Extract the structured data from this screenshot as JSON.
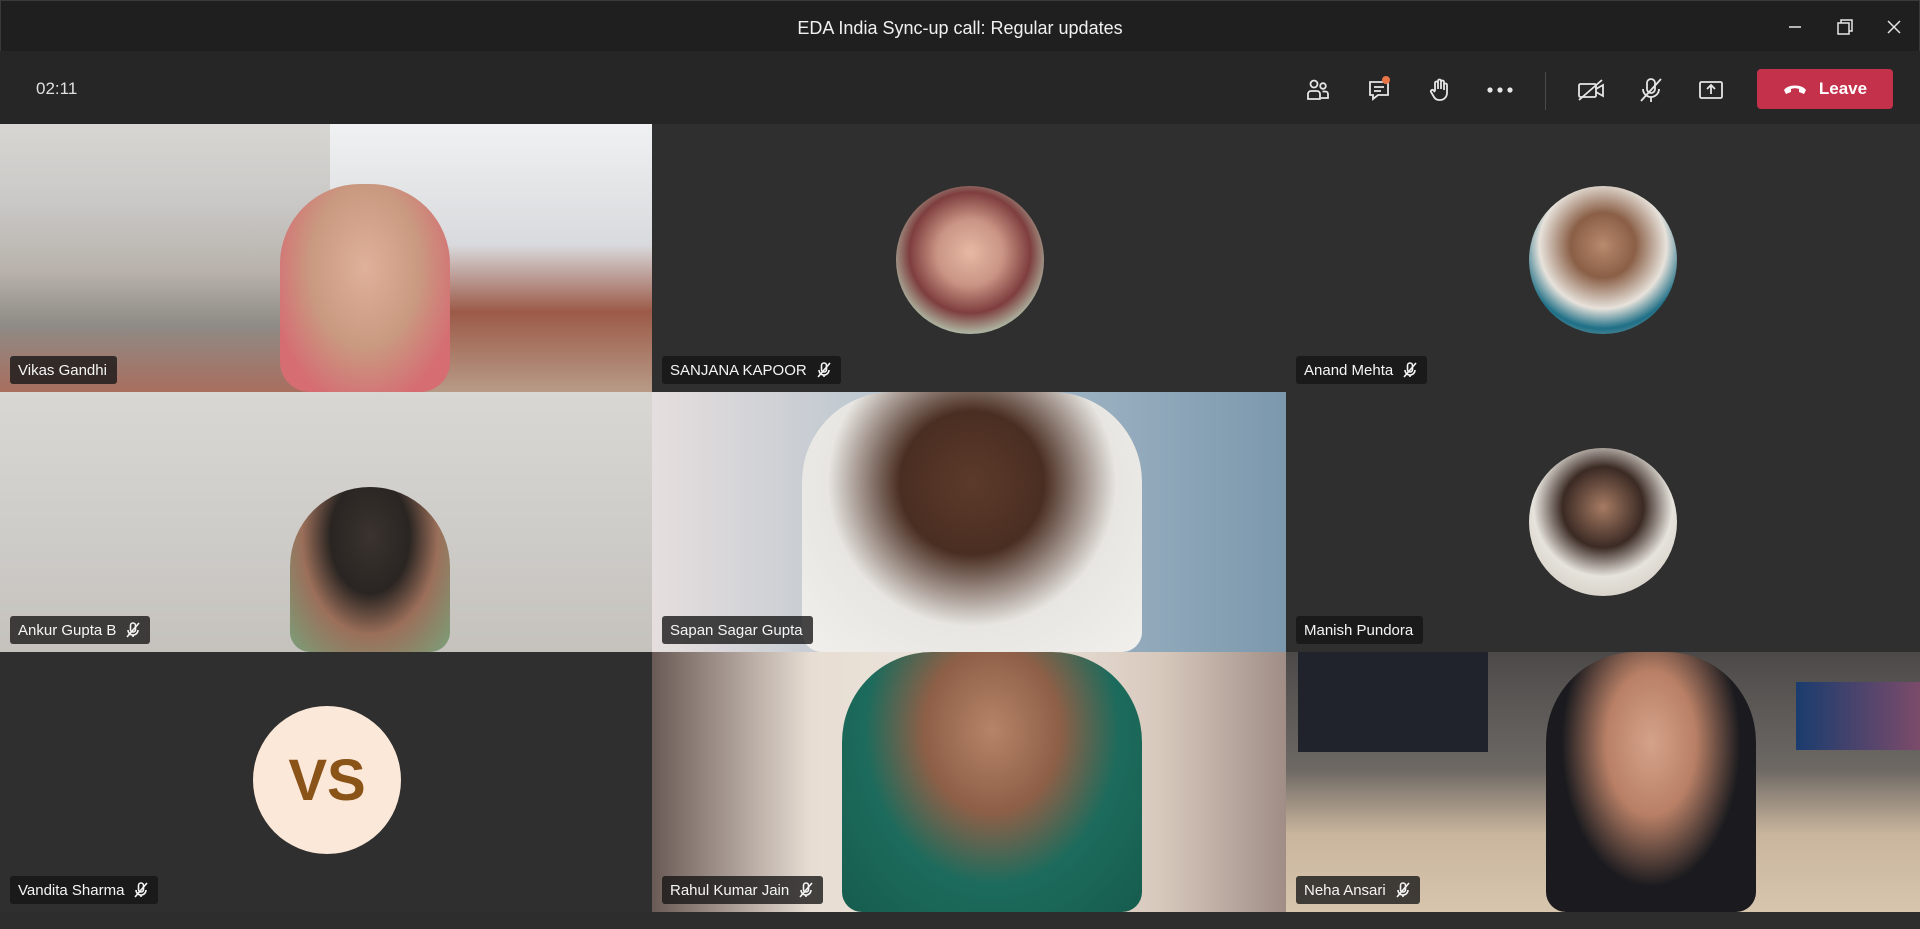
{
  "window": {
    "title": "EDA India Sync-up call: Regular updates"
  },
  "toolbar": {
    "timer": "02:11",
    "leave_label": "Leave",
    "icons": [
      "people-icon",
      "chat-icon",
      "raise-hand-icon",
      "more-icon",
      "camera-off-icon",
      "mic-off-icon",
      "share-screen-icon",
      "hang-up-icon"
    ],
    "leave_color": "#c4314b",
    "chat_notification_color": "#e97548"
  },
  "participants": [
    {
      "name": "Vikas Gandhi",
      "muted": false,
      "mode": "video"
    },
    {
      "name": "SANJANA KAPOOR",
      "muted": true,
      "mode": "photo"
    },
    {
      "name": "Anand Mehta",
      "muted": true,
      "mode": "photo"
    },
    {
      "name": "Ankur Gupta B",
      "muted": true,
      "mode": "video"
    },
    {
      "name": "Sapan Sagar Gupta",
      "muted": false,
      "mode": "video"
    },
    {
      "name": "Manish Pundora",
      "muted": false,
      "mode": "photo"
    },
    {
      "name": "Vandita Sharma",
      "muted": true,
      "mode": "initials",
      "initials": "VS"
    },
    {
      "name": "Rahul Kumar Jain",
      "muted": true,
      "mode": "video"
    },
    {
      "name": "Neha Ansari",
      "muted": true,
      "mode": "video"
    }
  ],
  "colors": {
    "background": "#1f1f1f",
    "tile": "#2f2f2f",
    "initials_bg": "#fbe8d9",
    "initials_text": "#8a5318"
  }
}
